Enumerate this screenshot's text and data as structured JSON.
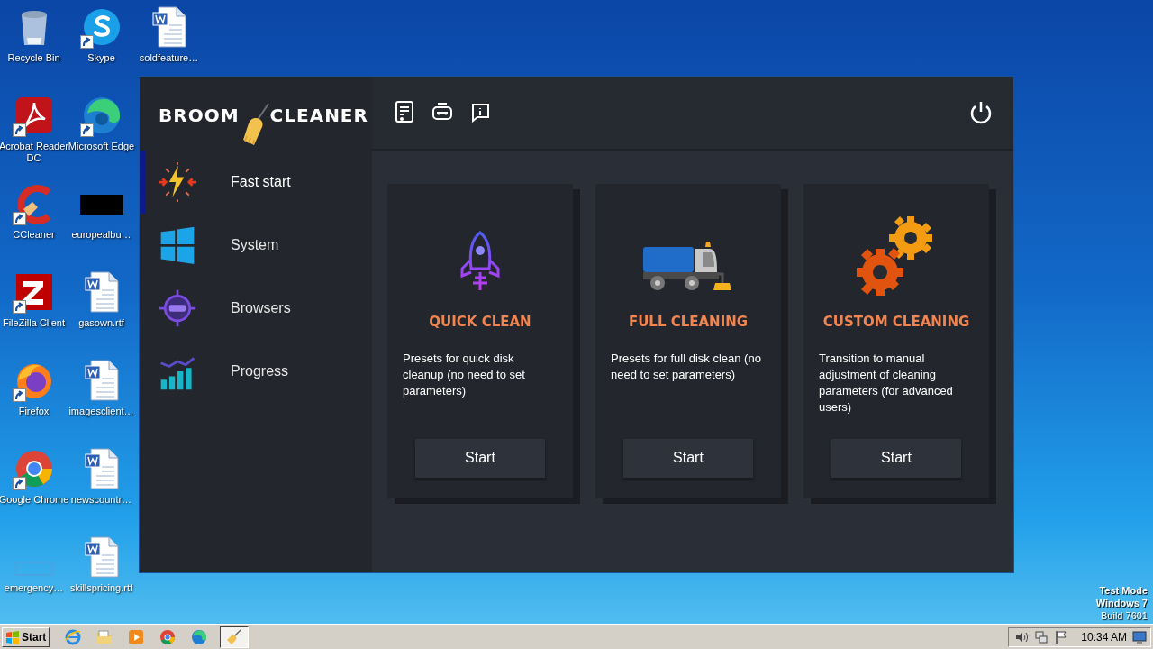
{
  "desktop": {
    "icons": [
      {
        "label": "Recycle Bin",
        "kind": "recycle",
        "shortcut": false
      },
      {
        "label": "Acrobat Reader DC",
        "kind": "acrobat",
        "shortcut": true
      },
      {
        "label": "CCleaner",
        "kind": "ccleaner",
        "shortcut": true
      },
      {
        "label": "FileZilla Client",
        "kind": "filezilla",
        "shortcut": true
      },
      {
        "label": "Firefox",
        "kind": "firefox",
        "shortcut": true
      },
      {
        "label": "Google Chrome",
        "kind": "chrome",
        "shortcut": true
      },
      {
        "label": "emergency…",
        "kind": "blank",
        "shortcut": false
      },
      {
        "label": "Skype",
        "kind": "skype",
        "shortcut": true
      },
      {
        "label": "Microsoft Edge",
        "kind": "edge",
        "shortcut": true
      },
      {
        "label": "europealbu…",
        "kind": "black",
        "shortcut": false
      },
      {
        "label": "gasown.rtf",
        "kind": "word",
        "shortcut": false
      },
      {
        "label": "imagesclient…",
        "kind": "word",
        "shortcut": false
      },
      {
        "label": "newscountr…",
        "kind": "word",
        "shortcut": false
      },
      {
        "label": "skillspricing.rtf",
        "kind": "word",
        "shortcut": false
      },
      {
        "label": "soldfeature…",
        "kind": "word",
        "shortcut": false
      }
    ],
    "os_notice": [
      "Test Mode",
      "Windows 7",
      "Build 7601"
    ]
  },
  "window": {
    "logo": {
      "left": "BROOM",
      "right": "CLEANER"
    },
    "sidebar": {
      "items": [
        {
          "label": "Fast start",
          "kind": "fast",
          "selected": true
        },
        {
          "label": "System",
          "kind": "system",
          "selected": false
        },
        {
          "label": "Browsers",
          "kind": "browsers",
          "selected": false
        },
        {
          "label": "Progress",
          "kind": "progress",
          "selected": false
        }
      ]
    },
    "cards": [
      {
        "title": "QUICK CLEAN",
        "kind": "rocket",
        "description": "Presets for quick disk cleanup (no need to set parameters)",
        "button": "Start"
      },
      {
        "title": "FULL CLEANING",
        "kind": "truck",
        "description": "Presets for full disk clean (no need to set parameters)",
        "button": "Start"
      },
      {
        "title": "CUSTOM CLEANING",
        "kind": "gears",
        "description": "Transition to manual adjustment of cleaning parameters (for advanced users)",
        "button": "Start"
      }
    ]
  },
  "taskbar": {
    "start": "Start",
    "apps": [
      {
        "kind": "ie",
        "active": false
      },
      {
        "kind": "folder",
        "active": false
      },
      {
        "kind": "media",
        "active": false
      },
      {
        "kind": "chrome",
        "active": false
      },
      {
        "kind": "edge",
        "active": false
      },
      {
        "kind": "broom",
        "active": true
      }
    ],
    "clock": "10:34 AM"
  }
}
